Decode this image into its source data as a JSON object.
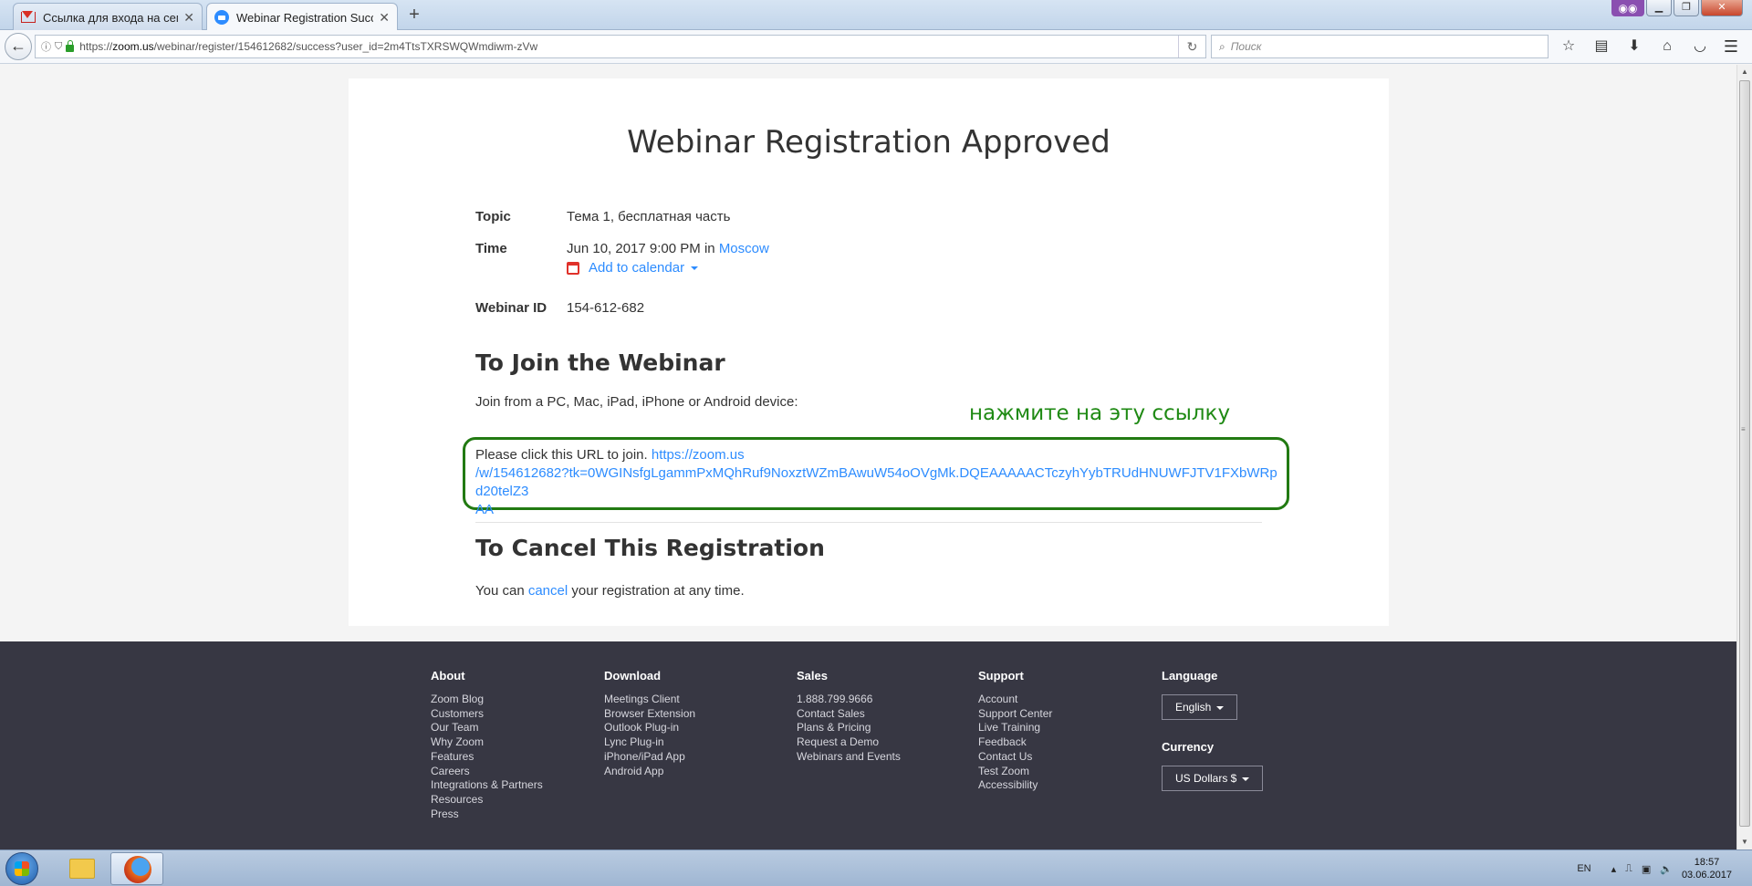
{
  "browser": {
    "tabs": [
      {
        "title": "Ссылка для входа на семин",
        "icon": "gmail-icon",
        "active": false
      },
      {
        "title": "Webinar Registration Succes",
        "icon": "zoom-icon",
        "active": true
      }
    ],
    "new_tab_label": "+",
    "url_domain": "zoom.us",
    "url_prefix": "https://",
    "url_path": "/webinar/register/154612682/success?user_id=2m4TtsTXRSWQWmdiwm-zVw",
    "search_placeholder": "Поиск"
  },
  "page": {
    "title": "Webinar Registration Approved",
    "topic_label": "Topic",
    "topic_value": "Тема 1, бесплатная часть",
    "time_label": "Time",
    "time_value": "Jun 10, 2017 9:00 PM",
    "time_in": "in",
    "time_zone": "Moscow",
    "add_to_calendar": "Add to calendar",
    "webinar_id_label": "Webinar ID",
    "webinar_id_value": "154-612-682",
    "join_heading": "To Join the Webinar",
    "join_devices": "Join from a PC, Mac, iPad, iPhone or Android device:",
    "annotation": "нажмите на эту ссылку",
    "join_prompt": "Please click this URL to join.",
    "join_url_line1": "https://zoom.us",
    "join_url_line2": "/w/154612682?tk=0WGINsfgLgammPxMQhRuf9NoxztWZmBAwuW54oOVgMk.DQEAAAAACTczyhYybTRUdHNUWFJTV1FXbWRpd20telZ3",
    "join_url_line3": "AA",
    "cancel_heading": "To Cancel This Registration",
    "cancel_text_before": "You can",
    "cancel_link": "cancel",
    "cancel_text_after": "your registration at any time."
  },
  "footer": {
    "about": {
      "heading": "About",
      "items": [
        "Zoom Blog",
        "Customers",
        "Our Team",
        "Why Zoom",
        "Features",
        "Careers",
        "Integrations & Partners",
        "Resources",
        "Press"
      ]
    },
    "download": {
      "heading": "Download",
      "items": [
        "Meetings Client",
        "Browser Extension",
        "Outlook Plug-in",
        "Lync Plug-in",
        "iPhone/iPad App",
        "Android App"
      ]
    },
    "sales": {
      "heading": "Sales",
      "items": [
        "1.888.799.9666",
        "Contact Sales",
        "Plans & Pricing",
        "Request a Demo",
        "Webinars and Events"
      ]
    },
    "support": {
      "heading": "Support",
      "items": [
        "Account",
        "Support Center",
        "Live Training",
        "Feedback",
        "Contact Us",
        "Test Zoom",
        "Accessibility"
      ]
    },
    "language": {
      "heading": "Language",
      "selected": "English"
    },
    "currency": {
      "heading": "Currency",
      "selected": "US Dollars $"
    }
  },
  "taskbar": {
    "language": "EN",
    "time": "18:57",
    "date": "03.06.2017"
  },
  "colors": {
    "link": "#2d8cff",
    "annotation": "#1f8a14",
    "footer_bg": "#373743",
    "calendar_icon": "#e0312a"
  }
}
